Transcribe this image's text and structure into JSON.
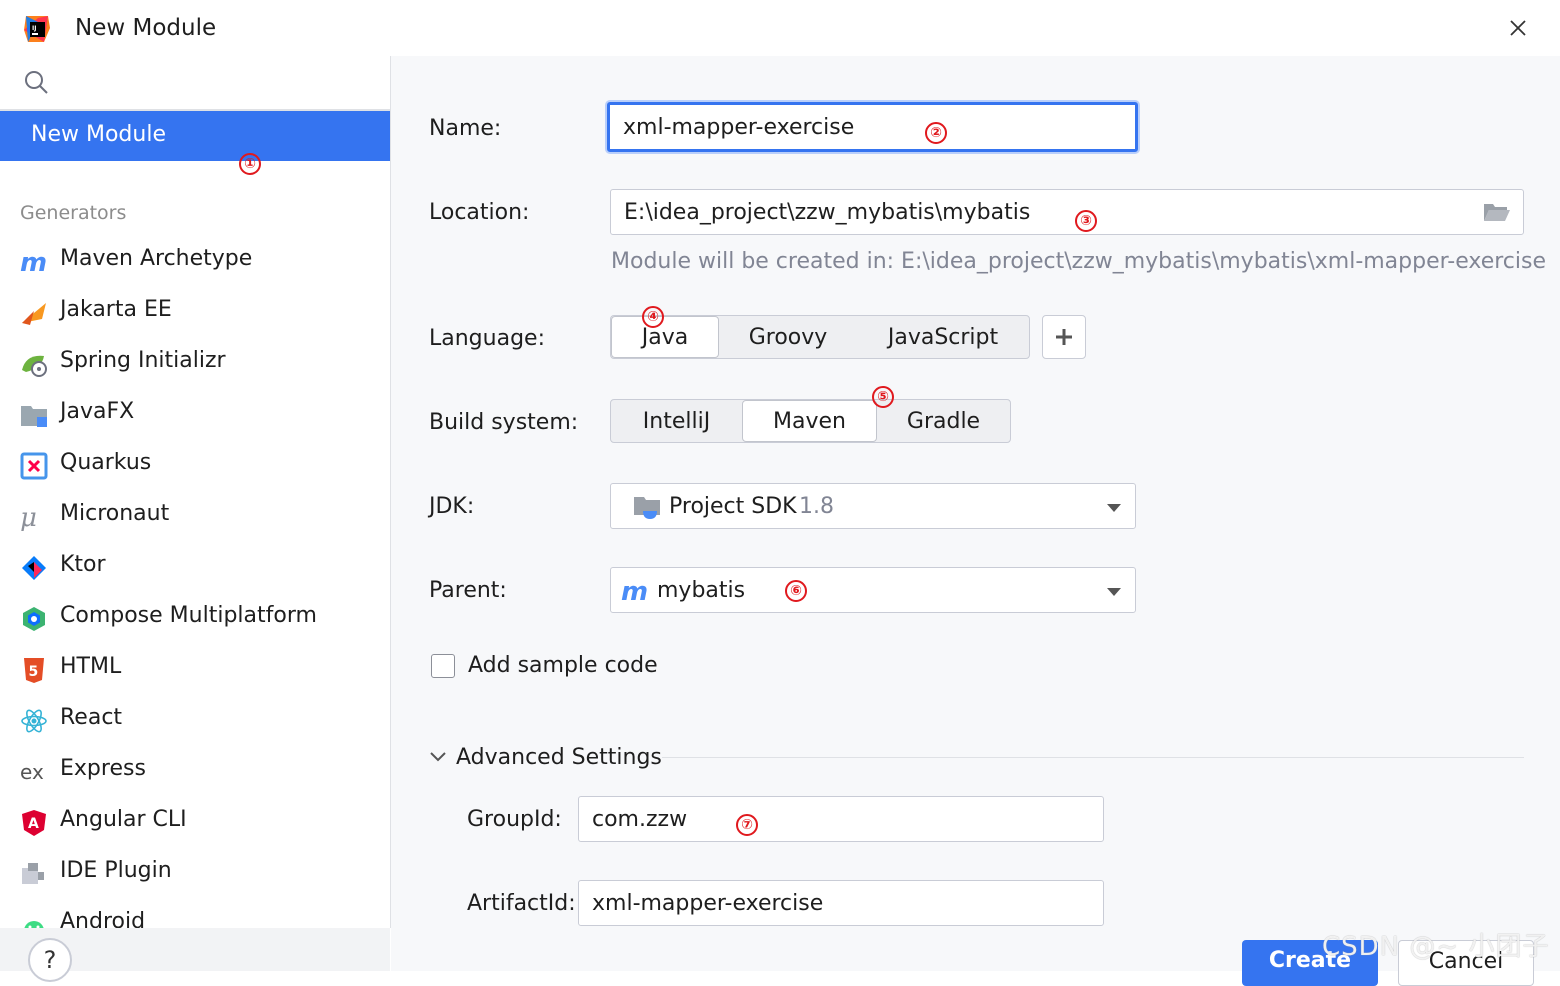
{
  "window": {
    "title": "New Module"
  },
  "sidebar": {
    "selected": "New Module",
    "section_header": "Generators",
    "items": [
      {
        "label": "Maven Archetype",
        "icon": "maven-icon"
      },
      {
        "label": "Jakarta EE",
        "icon": "jakarta-ee-icon"
      },
      {
        "label": "Spring Initializr",
        "icon": "spring-icon"
      },
      {
        "label": "JavaFX",
        "icon": "javafx-icon"
      },
      {
        "label": "Quarkus",
        "icon": "quarkus-icon"
      },
      {
        "label": "Micronaut",
        "icon": "micronaut-icon"
      },
      {
        "label": "Ktor",
        "icon": "ktor-icon"
      },
      {
        "label": "Compose Multiplatform",
        "icon": "compose-icon"
      },
      {
        "label": "HTML",
        "icon": "html5-icon"
      },
      {
        "label": "React",
        "icon": "react-icon"
      },
      {
        "label": "Express",
        "icon": "express-icon"
      },
      {
        "label": "Angular CLI",
        "icon": "angular-icon"
      },
      {
        "label": "IDE Plugin",
        "icon": "plugin-icon"
      },
      {
        "label": "Android",
        "icon": "android-icon"
      }
    ],
    "help_label": "?"
  },
  "form": {
    "name_label": "Name:",
    "name_value": "xml-mapper-exercise",
    "location_label": "Location:",
    "location_value": "E:\\idea_project\\zzw_mybatis\\mybatis",
    "location_hint": "Module will be created in: E:\\idea_project\\zzw_mybatis\\mybatis\\xml-mapper-exercise",
    "language_label": "Language:",
    "languages": [
      "Java",
      "Groovy",
      "JavaScript"
    ],
    "language_selected": "Java",
    "add_language": "+",
    "build_label": "Build system:",
    "build_systems": [
      "IntelliJ",
      "Maven",
      "Gradle"
    ],
    "build_selected": "Maven",
    "jdk_label": "JDK:",
    "jdk_value": "Project SDK",
    "jdk_version": "1.8",
    "parent_label": "Parent:",
    "parent_value": "mybatis",
    "sample_code_label": "Add sample code",
    "sample_code_checked": false,
    "advanced_label": "Advanced Settings",
    "groupid_label": "GroupId:",
    "groupid_value": "com.zzw",
    "artifactid_label": "ArtifactId:",
    "artifactid_value": "xml-mapper-exercise"
  },
  "footer": {
    "create_label": "Create",
    "cancel_label": "Cancel"
  },
  "markers": [
    "①",
    "②",
    "③",
    "④",
    "⑤",
    "⑥",
    "⑦"
  ],
  "watermark": "CSDN @~ 小团子",
  "colors": {
    "accent": "#3574f0",
    "marker": "#e0191e",
    "panel_bg": "#f7f8fa"
  }
}
